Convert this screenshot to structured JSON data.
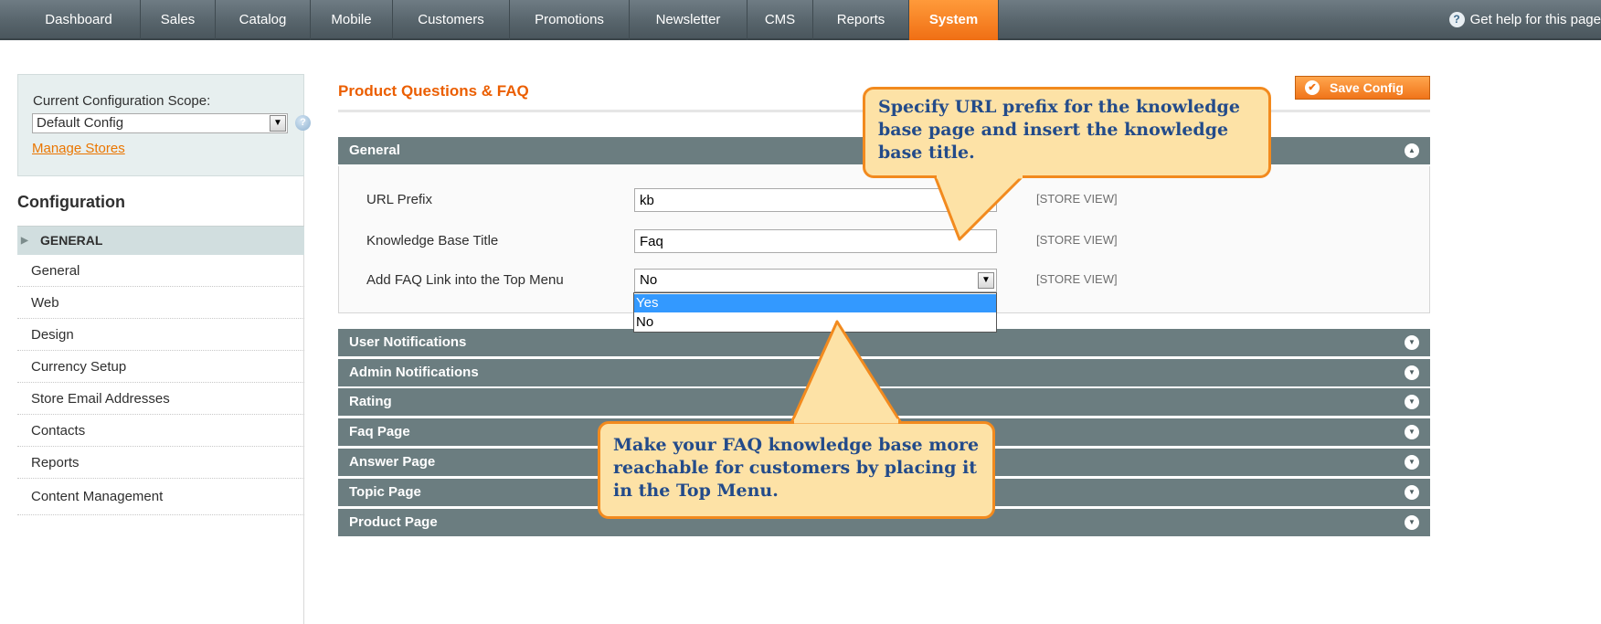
{
  "nav": {
    "items": [
      "Dashboard",
      "Sales",
      "Catalog",
      "Mobile",
      "Customers",
      "Promotions",
      "Newsletter",
      "CMS",
      "Reports",
      "System"
    ],
    "active": "System",
    "help_label": "Get help for this page"
  },
  "sidebar": {
    "scope_label": "Current Configuration Scope:",
    "scope_value": "Default Config",
    "manage_stores": "Manage Stores",
    "configuration_title": "Configuration",
    "group_label": "GENERAL",
    "items": [
      "General",
      "Web",
      "Design",
      "Currency Setup",
      "Store Email Addresses",
      "Contacts",
      "Reports",
      "Content Management"
    ]
  },
  "main": {
    "page_title": "Product Questions & FAQ",
    "save_label": "Save Config",
    "general_section": {
      "title": "General",
      "fields": [
        {
          "label": "URL Prefix",
          "value": "kb",
          "scope": "[STORE VIEW]"
        },
        {
          "label": "Knowledge Base Title",
          "value": "Faq",
          "scope": "[STORE VIEW]"
        },
        {
          "label": "Add FAQ Link into the Top Menu",
          "value": "No",
          "scope": "[STORE VIEW]"
        }
      ],
      "dropdown_options": [
        "Yes",
        "No"
      ],
      "dropdown_highlighted": "Yes"
    },
    "sections": [
      "User Notifications",
      "Admin Notifications",
      "Rating",
      "Faq Page",
      "Answer Page",
      "Topic Page",
      "Product Page"
    ]
  },
  "callouts": {
    "top": "Specify URL prefix for the knowledge base page and insert the knowledge base title.",
    "bottom": "Make your FAQ knowledge base more reachable for customers by placing it in the Top Menu."
  },
  "colors": {
    "accent": "#eb5e00",
    "nav_bg": "#58656c",
    "section_header": "#6b7d80",
    "callout_fill": "#fde2a6",
    "callout_border": "#f28a1e",
    "callout_text": "#234b8a"
  }
}
